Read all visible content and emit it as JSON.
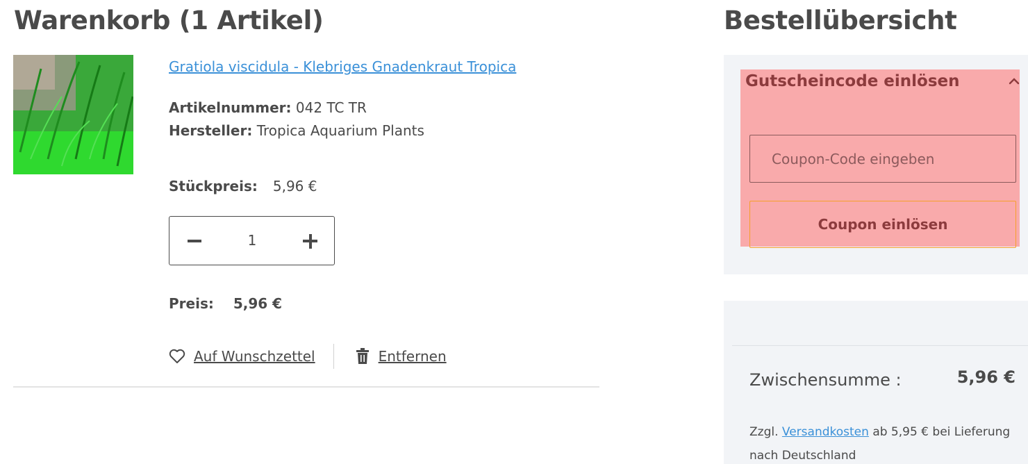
{
  "cart": {
    "title": "Warenkorb (1 Artikel)",
    "item": {
      "name": "Gratiola viscidula - Klebriges Gnadenkraut Tropica",
      "article_number_label": "Artikelnummer:",
      "article_number": "042 TC TR",
      "manufacturer_label": "Hersteller:",
      "manufacturer": "Tropica Aquarium Plants",
      "unit_price_label": "Stückpreis:",
      "unit_price": "5,96 €",
      "quantity": "1",
      "price_label": "Preis:",
      "price": "5,96 €",
      "wishlist_label": "Auf Wunschzettel",
      "remove_label": "Entfernen"
    }
  },
  "summary": {
    "title": "Bestellübersicht",
    "coupon": {
      "heading": "Gutscheincode einlösen",
      "input_placeholder": "Coupon-Code eingeben",
      "button_label": "Coupon einlösen"
    },
    "subtotal_label": "Zwischensumme :",
    "subtotal_value": "5,96 €",
    "shipping_prefix": "Zzgl.",
    "shipping_link": "Versandkosten",
    "shipping_suffix": "ab 5,95 € bei Lieferung nach Deutschland"
  },
  "colors": {
    "text": "#4a4a4a",
    "link": "#3a90d8",
    "highlight": "#f9aaab",
    "card_bg": "#f2f4f7",
    "button_border": "#f5a02a"
  },
  "icons": {
    "wishlist": "heart-icon",
    "remove": "trash-icon",
    "collapse": "chevron-up-icon",
    "decrease": "minus-icon",
    "increase": "plus-icon"
  }
}
